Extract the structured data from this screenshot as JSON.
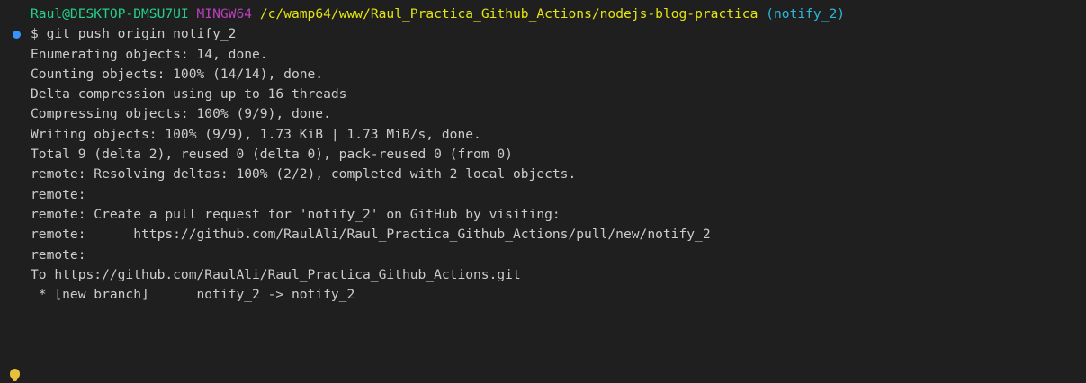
{
  "prompt": {
    "user_host": "Raul@DESKTOP-DMSU7UI",
    "env": "MINGW64",
    "path": "/c/wamp64/www/Raul_Practica_Github_Actions/nodejs-blog-practica",
    "branch": "(notify_2)"
  },
  "command": "$ git push origin notify_2",
  "output": [
    "Enumerating objects: 14, done.",
    "Counting objects: 100% (14/14), done.",
    "Delta compression using up to 16 threads",
    "Compressing objects: 100% (9/9), done.",
    "Writing objects: 100% (9/9), 1.73 KiB | 1.73 MiB/s, done.",
    "Total 9 (delta 2), reused 0 (delta 0), pack-reused 0 (from 0)",
    "remote: Resolving deltas: 100% (2/2), completed with 2 local objects.",
    "remote:",
    "remote: Create a pull request for 'notify_2' on GitHub by visiting:",
    "remote:      https://github.com/RaulAli/Raul_Practica_Github_Actions/pull/new/notify_2",
    "remote:",
    "To https://github.com/RaulAli/Raul_Practica_Github_Actions.git",
    " * [new branch]      notify_2 -> notify_2"
  ],
  "icons": {
    "command_status": "command-decoration-dot-icon",
    "hint": "lightbulb-icon"
  },
  "colors": {
    "background": "#1f1f1f",
    "text": "#cccccc",
    "user_host": "#23d18b",
    "env": "#bc3fbc",
    "path": "#e5e510",
    "branch": "#29b8db",
    "status_dot": "#3794ff",
    "lightbulb": "#e8c03a"
  }
}
